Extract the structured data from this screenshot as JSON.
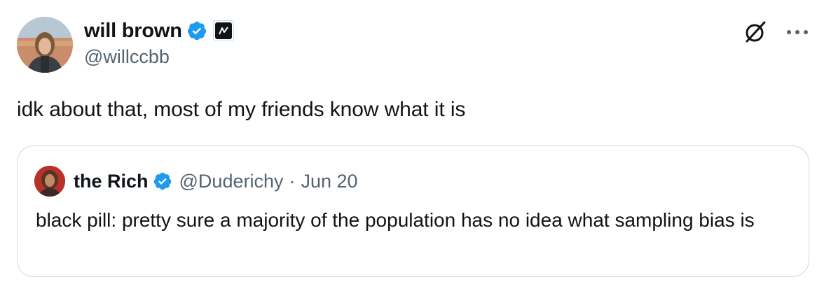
{
  "author": {
    "display_name": "will brown",
    "handle": "@willccbb",
    "avatar_icon": "user-avatar-photo",
    "verified_icon": "verified-badge-icon",
    "affiliation_icon": "affiliation-badge-icon"
  },
  "actions": {
    "grok_icon": "grok-icon",
    "more_icon": "more-options-icon"
  },
  "tweet": {
    "text": "idk about that, most of my friends know what it is"
  },
  "quoted": {
    "display_name": "the Rich",
    "handle": "@Duderichy",
    "separator": "·",
    "date": "Jun 20",
    "text": "black pill: pretty sure a majority of the population has no idea what sampling bias is"
  },
  "colors": {
    "text_primary": "#0f1419",
    "text_secondary": "#536471",
    "verified_blue": "#1d9bf0",
    "border": "#cfd9de"
  }
}
